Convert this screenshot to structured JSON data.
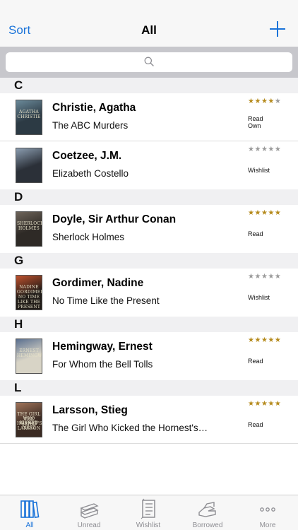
{
  "nav": {
    "left_label": "Sort",
    "title": "All",
    "add_icon": "plus-icon"
  },
  "search": {
    "icon": "magnifier-icon"
  },
  "colors": {
    "accent": "#1a73d9",
    "star_on": "#b58a1c",
    "star_off": "#9a9a9a"
  },
  "sections": [
    {
      "letter": "C",
      "books": [
        {
          "author": "Christie, Agatha",
          "title": "The ABC Murders",
          "rating": 4,
          "status": [
            "Read",
            "Own"
          ],
          "cover_text": [
            "AGATHA",
            "CHRISTIE"
          ],
          "cover_bg": "#2c3a44",
          "cover_accent": "#6b8a9a"
        },
        {
          "author": "Coetzee, J.M.",
          "title": "Elizabeth Costello",
          "rating": 0,
          "status": [
            "Wishlist"
          ],
          "cover_text": [],
          "cover_bg": "#2b3038",
          "cover_accent": "#8b9db0"
        }
      ]
    },
    {
      "letter": "D",
      "books": [
        {
          "author": "Doyle, Sir Arthur Conan",
          "title": "Sherlock Holmes",
          "rating": 5,
          "status": [
            "Read"
          ],
          "cover_text": [
            "SHERLOCK",
            "HOLMES"
          ],
          "cover_bg": "#2e2a26",
          "cover_accent": "#6d645a"
        }
      ]
    },
    {
      "letter": "G",
      "books": [
        {
          "author": "Gordimer, Nadine",
          "title": "No Time Like the Present",
          "rating": 0,
          "status": [
            "Wishlist"
          ],
          "cover_text": [
            "NADINE",
            "GORDIMER",
            "NO TIME",
            "LIKE THE",
            "PRESENT"
          ],
          "cover_bg": "#1f1a16",
          "cover_accent": "#c0522e"
        }
      ]
    },
    {
      "letter": "H",
      "books": [
        {
          "author": "Hemingway, Ernest",
          "title": "For Whom the Bell Tolls",
          "rating": 5,
          "status": [
            "Read"
          ],
          "cover_text": [
            "ERNEST",
            "HEMINGWAY"
          ],
          "cover_bg": "#d8d4c6",
          "cover_accent": "#5a6f8f"
        }
      ]
    },
    {
      "letter": "L",
      "books": [
        {
          "author": "Larsson, Stieg",
          "title": "The Girl Who Kicked the Hornest's…",
          "rating": 5,
          "status": [
            "Read"
          ],
          "cover_text": [
            "THE GIRL WHO KICKED",
            "THE HORNET'S NEST",
            "STIEG LARSSON"
          ],
          "cover_bg": "#3a2a22",
          "cover_accent": "#a0745a"
        }
      ]
    }
  ],
  "tabs": [
    {
      "label": "All",
      "icon": "books-shelf-icon",
      "active": true
    },
    {
      "label": "Unread",
      "icon": "book-stack-icon",
      "active": false
    },
    {
      "label": "Wishlist",
      "icon": "checklist-icon",
      "active": false
    },
    {
      "label": "Borrowed",
      "icon": "hand-book-icon",
      "active": false
    },
    {
      "label": "More",
      "icon": "more-dots-icon",
      "active": false
    }
  ]
}
